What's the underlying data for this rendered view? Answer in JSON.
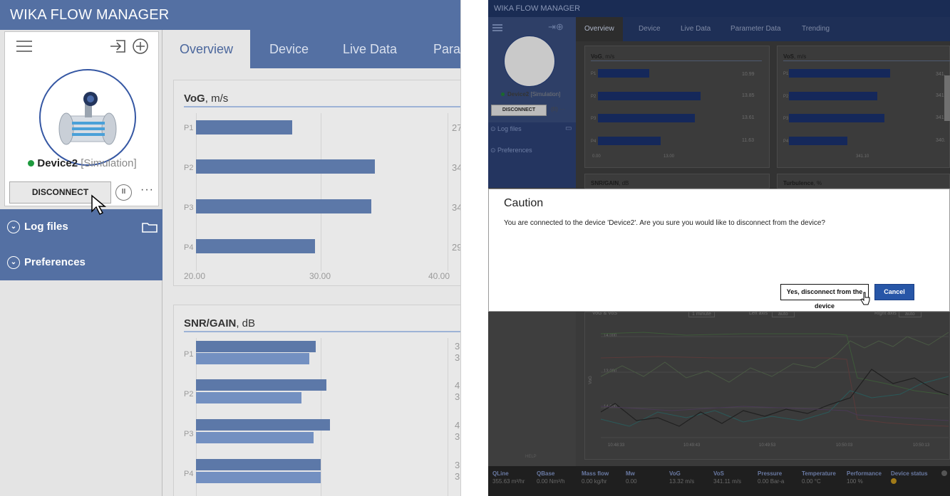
{
  "left": {
    "app_title": "WIKA FLOW MANAGER",
    "device": {
      "name": "Device2",
      "mode": "[Simulation]",
      "status_color": "#1e9a3e"
    },
    "disconnect_label": "DISCONNECT",
    "pause_label": "II",
    "more_label": "···",
    "nav": [
      {
        "label": "Log files"
      },
      {
        "label": "Preferences"
      }
    ],
    "tabs": [
      {
        "label": "Overview"
      },
      {
        "label": "Device"
      },
      {
        "label": "Live Data"
      },
      {
        "label": "Para"
      }
    ],
    "vog": {
      "title": "VoG",
      "unit": ", m/s",
      "bars": [
        {
          "label": "P1",
          "value": "27"
        },
        {
          "label": "P2",
          "value": "34"
        },
        {
          "label": "P3",
          "value": "34"
        },
        {
          "label": "P4",
          "value": "29"
        }
      ],
      "ticks": [
        "20.00",
        "30.00",
        "40.00"
      ]
    },
    "snr": {
      "title": "SNR/GAIN",
      "unit": ", dB",
      "bars": [
        {
          "label": "P1",
          "v1": "3",
          "v2": "3"
        },
        {
          "label": "P2",
          "v1": "4",
          "v2": "3"
        },
        {
          "label": "P3",
          "v1": "4",
          "v2": "3"
        },
        {
          "label": "P4",
          "v1": "3",
          "v2": "3"
        }
      ]
    }
  },
  "right": {
    "app_title": "WIKA FLOW MANAGER",
    "device": {
      "name": "Device2",
      "mode": "[Simulation]"
    },
    "disconnect_label": "DISCONNECT",
    "nav": [
      {
        "label": "Log files"
      },
      {
        "label": "Preferences"
      }
    ],
    "tabs": [
      {
        "label": "Overview"
      },
      {
        "label": "Device"
      },
      {
        "label": "Live Data"
      },
      {
        "label": "Parameter Data"
      },
      {
        "label": "Trending"
      }
    ],
    "vog": {
      "title": "VoG",
      "unit": ", m/s",
      "bars": [
        {
          "label": "P1",
          "value": "10.99"
        },
        {
          "label": "P2",
          "value": "13.85"
        },
        {
          "label": "P3",
          "value": "13.61"
        },
        {
          "label": "P4",
          "value": "11.63"
        }
      ],
      "ticks": [
        "0.00",
        "13.00"
      ]
    },
    "vos": {
      "title": "VoS",
      "unit": ", m/s",
      "bars": [
        {
          "label": "P1",
          "value": "341."
        },
        {
          "label": "P2",
          "value": "341."
        },
        {
          "label": "P3",
          "value": "341."
        },
        {
          "label": "P4",
          "value": "340."
        }
      ],
      "ticks": [
        "341.10"
      ]
    },
    "snr_title": "SNR/GAIN",
    "snr_unit": ", dB",
    "turb_title": "Turbulence",
    "turb_unit": ", %",
    "trend": {
      "title": "VoG & VoS",
      "interval": "1 minute",
      "left_axis": "Left axis",
      "left_val": "auto",
      "right_axis": "Right axis",
      "right_val": "auto",
      "ylabel": "VoG",
      "yticks": [
        "14.000",
        "13.000",
        "14.000"
      ],
      "xticks": [
        "10:48:33",
        "10:49:43",
        "10:49:53",
        "10:50:03",
        "10:50:13"
      ],
      "help": "HELP"
    },
    "dialog": {
      "title": "Caution",
      "message": "You are connected to the device 'Device2'. Are you sure you would like to disconnect from the device?",
      "confirm": "Yes, disconnect from the device",
      "cancel": "Cancel"
    },
    "status": [
      {
        "h": "QLine",
        "v": "355.63 m³/hr"
      },
      {
        "h": "QBase",
        "v": "0.00 Nm³/h"
      },
      {
        "h": "Mass flow",
        "v": "0.00 kg/hr"
      },
      {
        "h": "Mw",
        "v": "0.00"
      },
      {
        "h": "VoG",
        "v": "13.32 m/s"
      },
      {
        "h": "VoS",
        "v": "341.11 m/s"
      },
      {
        "h": "Pressure",
        "v": "0.00 Bar-a"
      },
      {
        "h": "Temperature",
        "v": "0.00 °C"
      },
      {
        "h": "Performance",
        "v": "100 %"
      },
      {
        "h": "Device status",
        "v": ""
      }
    ]
  }
}
